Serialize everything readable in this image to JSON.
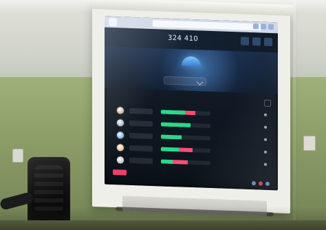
{
  "browser": {
    "tab_title": "",
    "address": ""
  },
  "app": {
    "brand": "",
    "price": "324 410",
    "header_buttons": [
      "",
      "",
      ""
    ]
  },
  "banner": {
    "tag": "",
    "select_label": ""
  },
  "table": {
    "head_name": "",
    "head_rank": "",
    "head_right": "",
    "rows": [
      {
        "value": ""
      },
      {
        "value": ""
      },
      {
        "value": ""
      },
      {
        "value": ""
      },
      {
        "value": ""
      }
    ],
    "bars": [
      {
        "green": 0.48,
        "red": 0.22
      },
      {
        "green": 0.6,
        "red": 0.0
      },
      {
        "green": 0.42,
        "red": 0.0
      },
      {
        "green": 0.36,
        "red": 0.28
      },
      {
        "green": 0.24,
        "red": 0.3
      }
    ]
  },
  "footer": {
    "link": ""
  },
  "taskbar": {
    "clock": ""
  },
  "colors": {
    "green": "#2bd889",
    "red": "#ff4d76"
  },
  "icons": {
    "gauge": "gauge-icon",
    "chevron": "chevron-down-icon",
    "toggle": "toggle-icon",
    "avatar": "avatar-icon"
  }
}
